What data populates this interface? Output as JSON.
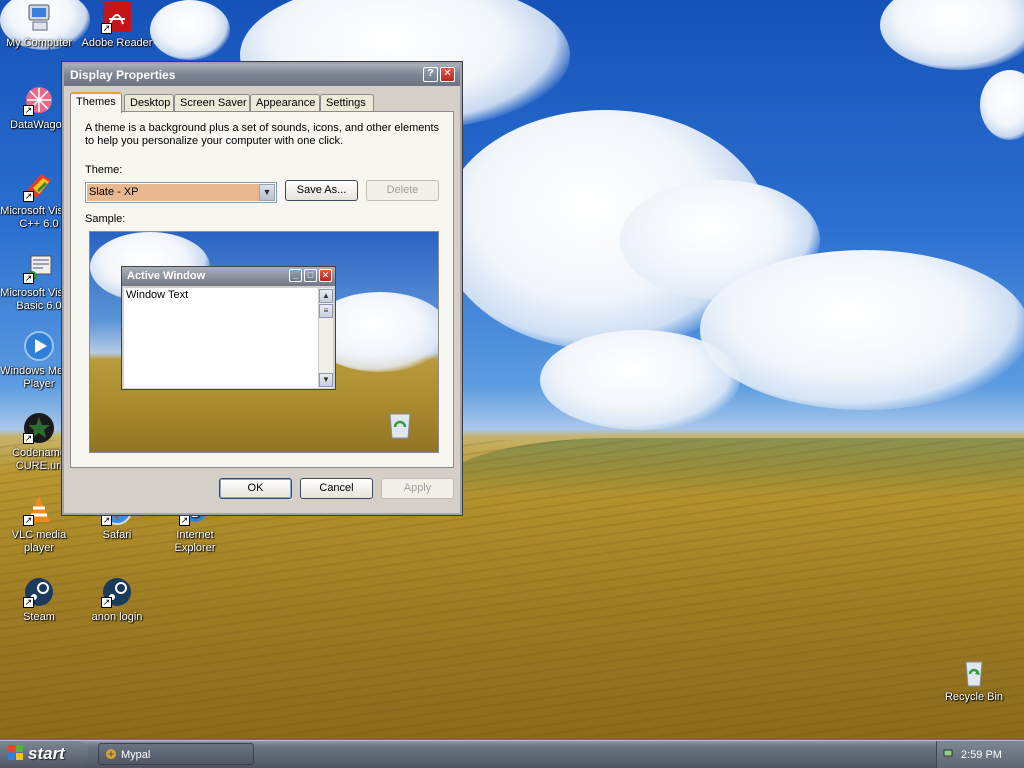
{
  "desktop": {
    "icons": [
      {
        "label": "My Computer",
        "icon": "my-computer-icon"
      },
      {
        "label": "Adobe Reader XI",
        "icon": "adobe-reader-icon"
      },
      {
        "label": "DataWagon",
        "icon": "datawagon-icon"
      },
      {
        "label": "Microsoft Visual C++ 6.0",
        "icon": "visual-cpp-icon"
      },
      {
        "label": "Microsoft Visual Basic 6.0",
        "icon": "visual-basic-icon"
      },
      {
        "label": "Windows Media Player",
        "icon": "media-player-icon"
      },
      {
        "label": "Codename CURE.url",
        "icon": "codename-cure-icon"
      },
      {
        "label": "VLC media player",
        "icon": "vlc-icon"
      },
      {
        "label": "Safari",
        "icon": "safari-icon"
      },
      {
        "label": "Internet Explorer",
        "icon": "internet-explorer-icon"
      },
      {
        "label": "Steam",
        "icon": "steam-icon"
      },
      {
        "label": "anon login",
        "icon": "steam-icon"
      },
      {
        "label": "Recycle Bin",
        "icon": "recycle-bin-icon"
      }
    ]
  },
  "dialog": {
    "title": "Display Properties",
    "help_glyph": "?",
    "close_glyph": "✕",
    "tabs": [
      "Themes",
      "Desktop",
      "Screen Saver",
      "Appearance",
      "Settings"
    ],
    "active_tab": "Themes",
    "description": "A theme is a background plus a set of sounds, icons, and other elements to help you personalize your computer with one click.",
    "theme_label": "Theme:",
    "theme_value": "Slate - XP",
    "save_as_label": "Save As...",
    "delete_label": "Delete",
    "sample_label": "Sample:",
    "sample": {
      "window_title": "Active Window",
      "window_text": "Window Text"
    },
    "ok_label": "OK",
    "cancel_label": "Cancel",
    "apply_label": "Apply"
  },
  "taskbar": {
    "start_label": "start",
    "tasks": [
      {
        "label": "Mypal",
        "icon": "mypal-icon"
      }
    ],
    "clock": "2:59 PM"
  },
  "colors": {
    "title_bar": "#7e8794",
    "selected_theme": "#e8b88e",
    "close_button": "#c73b2f"
  }
}
